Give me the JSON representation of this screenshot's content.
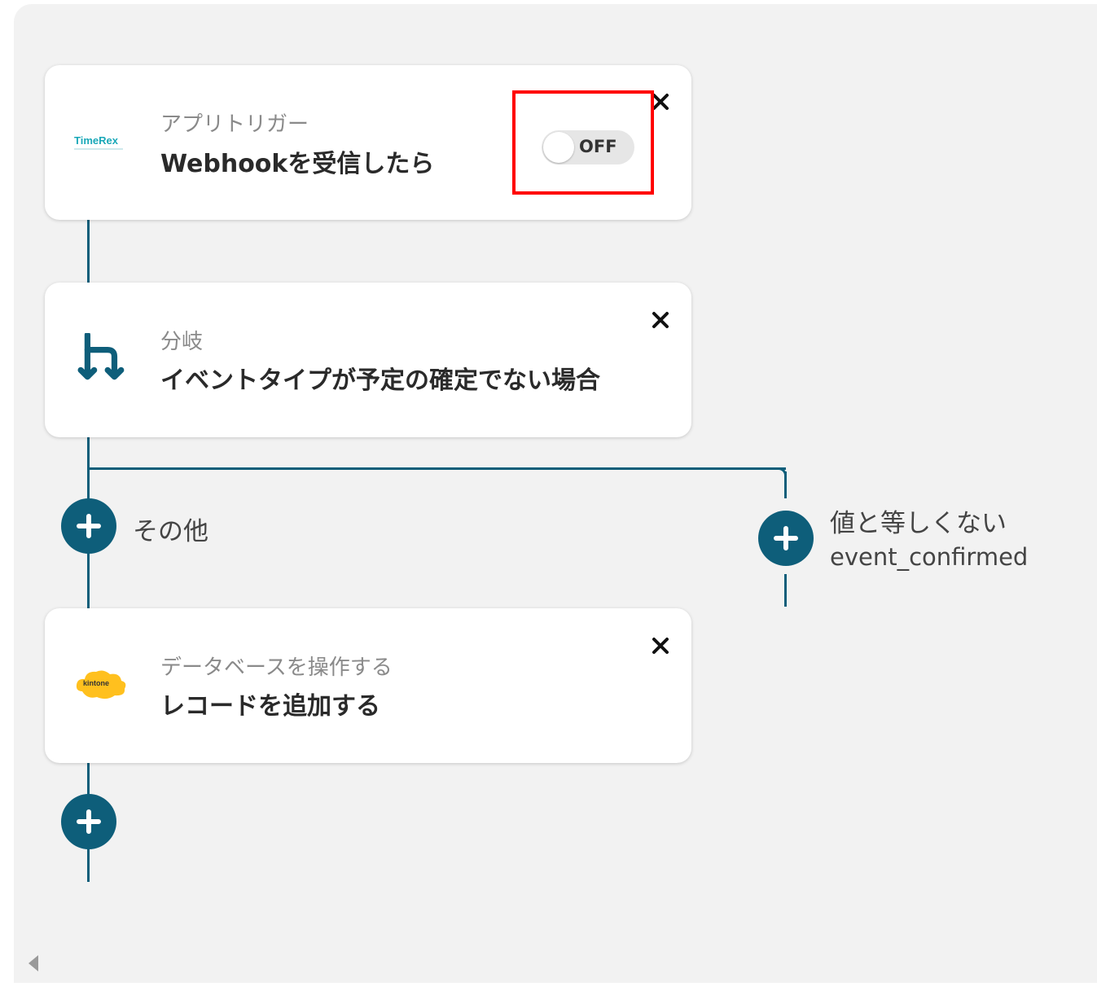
{
  "trigger_card": {
    "app_logo": "TimeRex",
    "subtitle": "アプリトリガー",
    "title": "Webhookを受信したら",
    "toggle_label": "OFF",
    "close_icon": "close-icon"
  },
  "branch_card": {
    "icon": "branch-icon",
    "subtitle": "分岐",
    "title": "イベントタイプが予定の確定でない場合",
    "close_icon": "close-icon"
  },
  "branches": {
    "left_label": "その他",
    "right_label_1": "値と等しくない",
    "right_label_2": "event_confirmed"
  },
  "database_card": {
    "app_logo": "kintone",
    "subtitle": "データベースを操作する",
    "title": "レコードを追加する",
    "close_icon": "close-icon"
  },
  "colors": {
    "accent": "#0e5e7a",
    "canvas": "#f2f2f2",
    "highlight": "#ff0000",
    "kintone": "#ffc01e",
    "timerex": "#1aa8b8"
  }
}
